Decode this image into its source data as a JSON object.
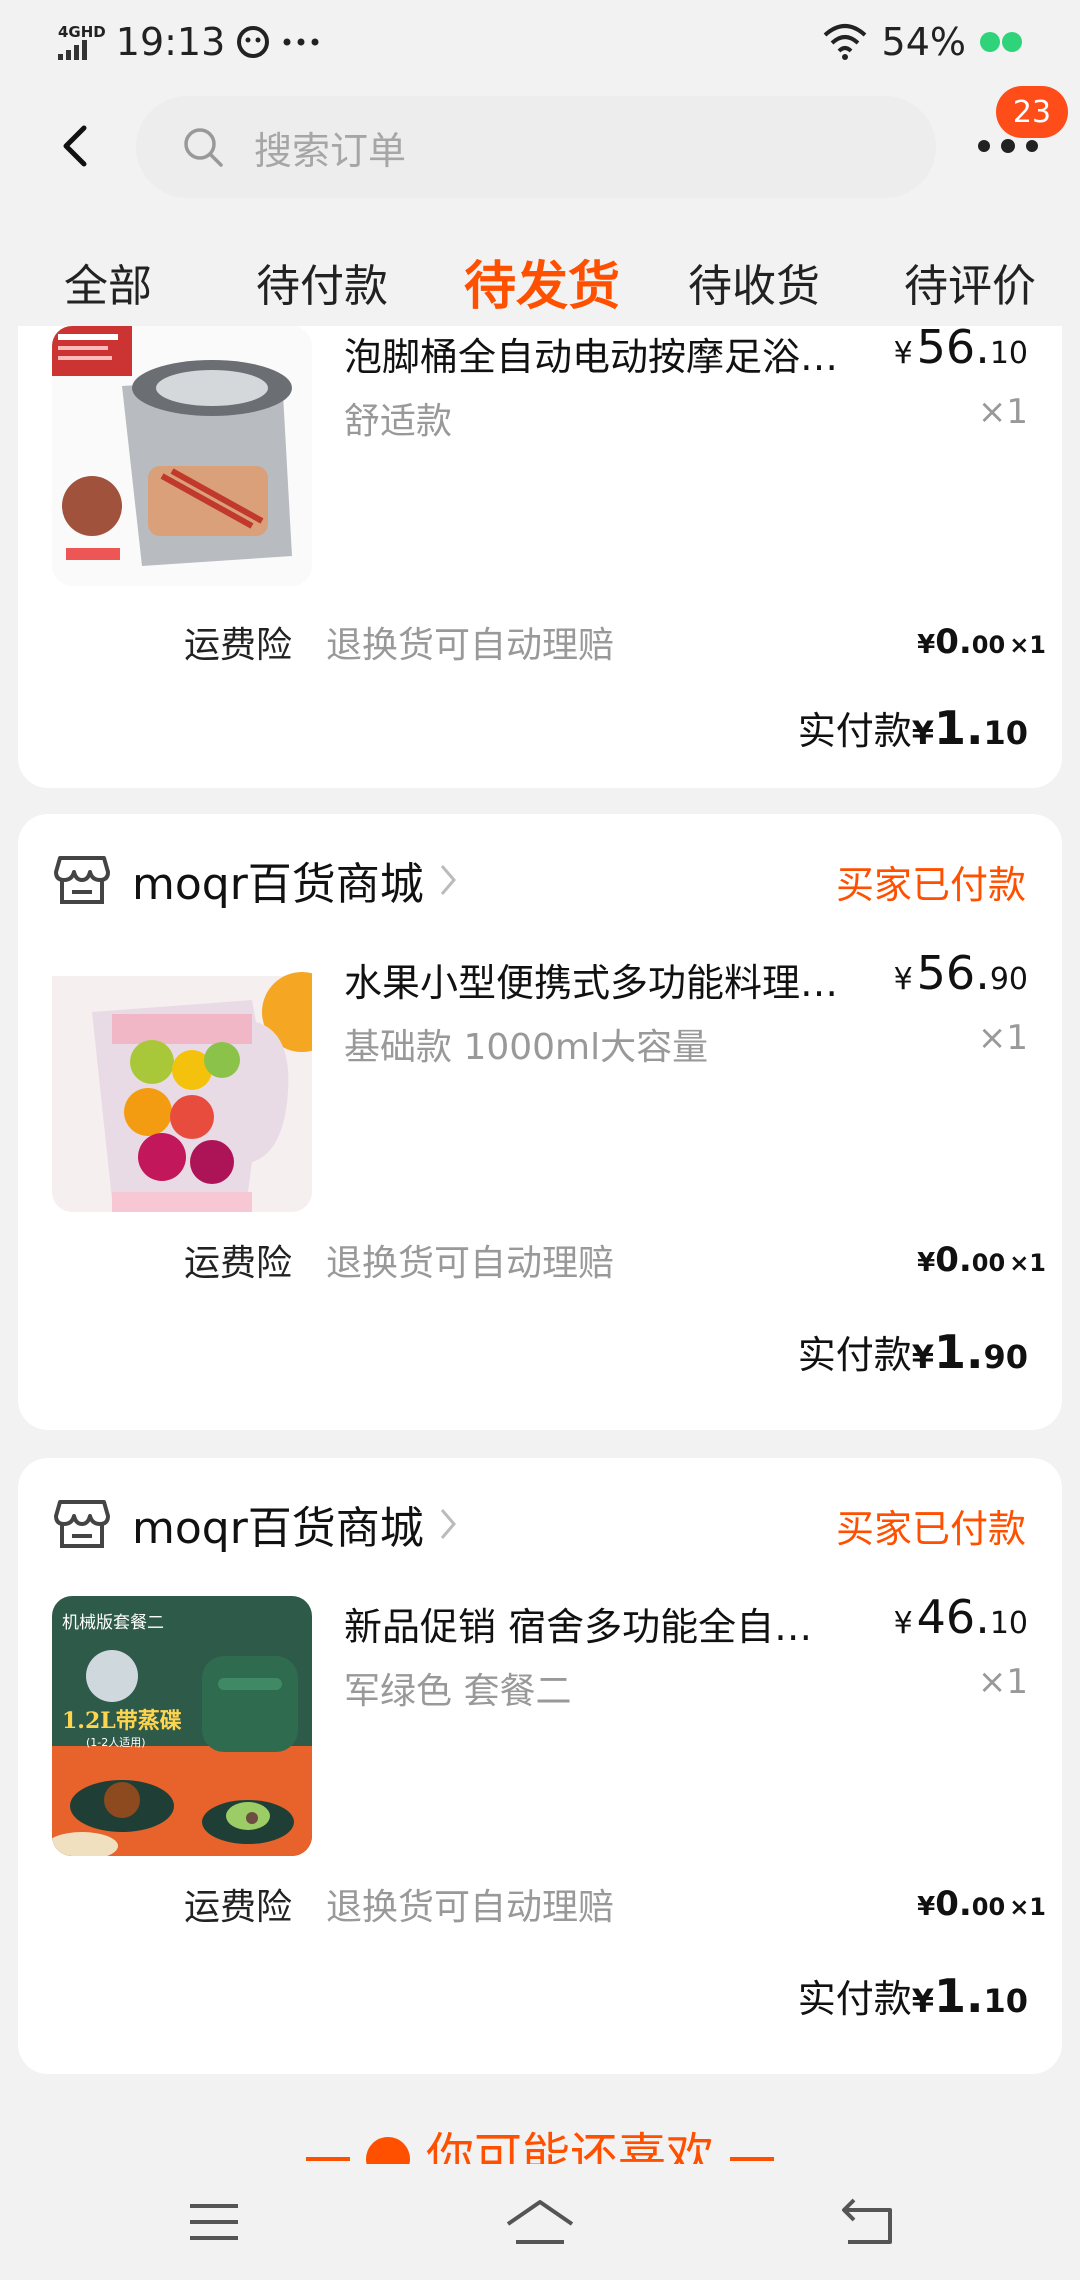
{
  "status_bar": {
    "network": "4G",
    "network_sup": "HD",
    "time": "19:13",
    "battery": "54%"
  },
  "search": {
    "placeholder": "搜索订单",
    "badge_count": "23"
  },
  "tabs": [
    {
      "label": "全部"
    },
    {
      "label": "待付款"
    },
    {
      "label": "待发货",
      "active": true
    },
    {
      "label": "待收货"
    },
    {
      "label": "待评价"
    }
  ],
  "orders": [
    {
      "store": "",
      "status": "",
      "product": {
        "name": "泡脚桶全自动电动按摩足浴…",
        "sku": "舒适款",
        "price_currency": "¥",
        "price_int": "56.",
        "price_dec": "10",
        "qty": "×1",
        "image": "foot-bath-image"
      },
      "insurance": {
        "label": "运费险",
        "desc": "退换货可自动理赔",
        "cur": "¥",
        "int": "0.",
        "dec": "00",
        "qty": "×1"
      },
      "paid": {
        "label": "实付款",
        "cur": "¥",
        "int": "1.",
        "dec": "10"
      }
    },
    {
      "store": "moqr百货商城",
      "status": "买家已付款",
      "product": {
        "name": "水果小型便携式多功能料理…",
        "sku": "基础款 1000ml大容量",
        "price_currency": "¥",
        "price_int": "56.",
        "price_dec": "90",
        "qty": "×1",
        "image": "juicer-image"
      },
      "insurance": {
        "label": "运费险",
        "desc": "退换货可自动理赔",
        "cur": "¥",
        "int": "0.",
        "dec": "00",
        "qty": "×1"
      },
      "paid": {
        "label": "实付款",
        "cur": "¥",
        "int": "1.",
        "dec": "90"
      }
    },
    {
      "store": "moqr百货商城",
      "status": "买家已付款",
      "product": {
        "name": "新品促销 宿舍多功能全自…",
        "sku": "军绿色 套餐二",
        "price_currency": "¥",
        "price_int": "46.",
        "price_dec": "10",
        "qty": "×1",
        "image": "rice-cooker-image",
        "image_caption_top": "机械版套餐二",
        "image_caption_main": "1.2L带蒸碟",
        "image_caption_sub": "(1-2人适用)"
      },
      "insurance": {
        "label": "运费险",
        "desc": "退换货可自动理赔",
        "cur": "¥",
        "int": "0.",
        "dec": "00",
        "qty": "×1"
      },
      "paid": {
        "label": "实付款",
        "cur": "¥",
        "int": "1.",
        "dec": "10"
      }
    }
  ],
  "recommend": {
    "title": "你可能还喜欢"
  },
  "colors": {
    "accent": "#ff5000",
    "badge": "#ff4d1a",
    "background": "#f2f2f2",
    "muted_text": "#999999"
  }
}
